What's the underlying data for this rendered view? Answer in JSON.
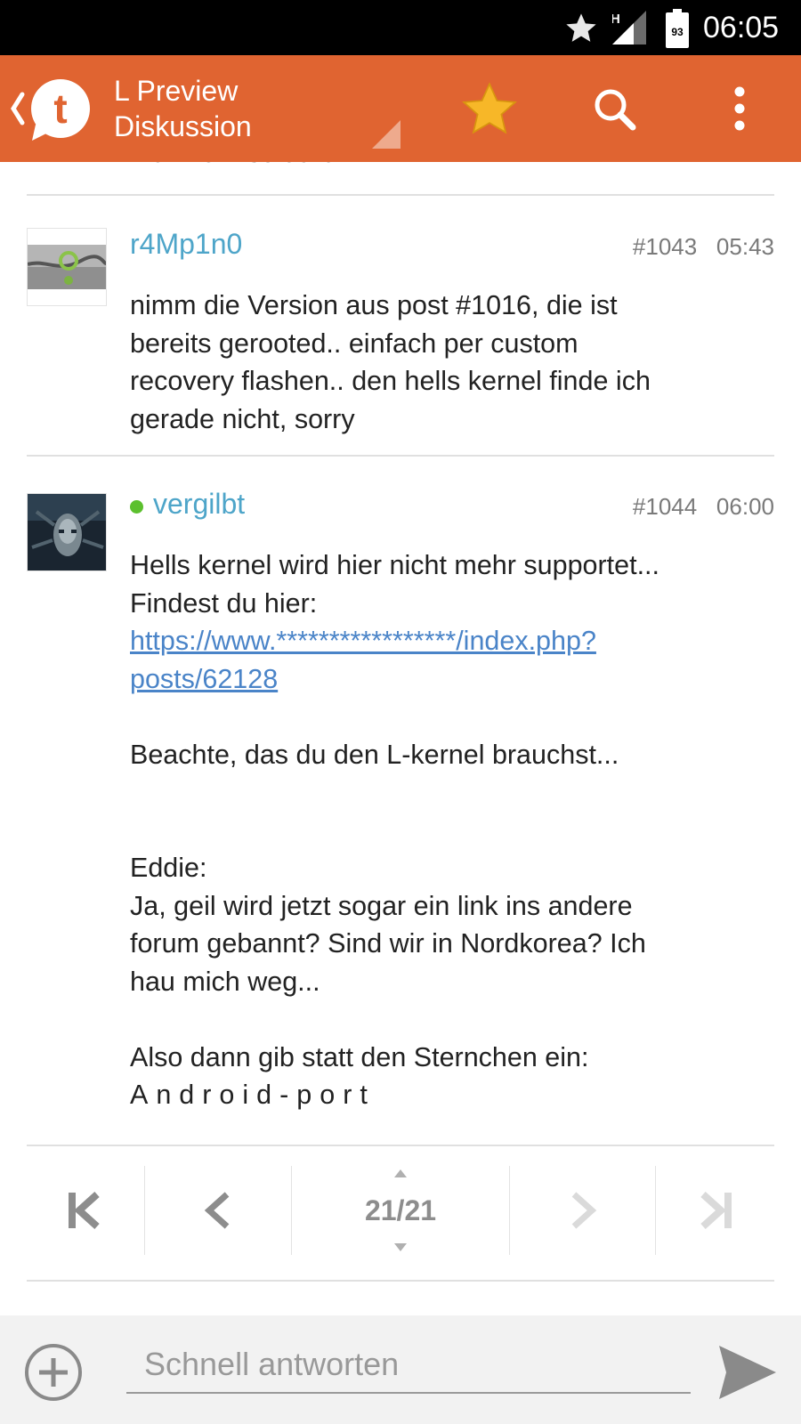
{
  "status_bar": {
    "time": "06:05",
    "network": "H",
    "battery": "93",
    "icons": [
      "star-icon",
      "signal-icon",
      "battery-icon"
    ]
  },
  "app_bar": {
    "title_line1": "L Preview",
    "title_line2": "Diskussion",
    "icons": [
      "back-chevron-icon",
      "app-logo-icon",
      "favorite-star-icon",
      "search-icon",
      "more-vert-icon"
    ],
    "accent_color": "#e06431",
    "star_color": "#f7b728"
  },
  "thread": {
    "partial_previous_text": "nichmehr so durch xD",
    "posts": [
      {
        "author": "r4Mp1n0",
        "number": "#1043",
        "time": "05:43",
        "online": false,
        "body_lines": [
          "nimm die Version aus post #1016, die ist",
          "bereits gerooted.. einfach per custom",
          "recovery flashen.. den hells kernel finde ich",
          "gerade nicht, sorry"
        ]
      },
      {
        "author": "vergilbt",
        "number": "#1044",
        "time": "06:00",
        "online": true,
        "online_color": "#5cc02e",
        "line1": "Hells kernel wird hier nicht mehr supportet...",
        "line2": "Findest du hier:",
        "link_line1": "https://www.*****************/index.php?",
        "link_line2": "posts/62128",
        "line3": "Beachte, das du den L-kernel brauchst...",
        "line4": "Eddie:",
        "line5": "Ja, geil wird jetzt sogar ein link ins andere",
        "line6": "forum gebannt? Sind wir in Nordkorea? Ich",
        "line7": "hau mich weg...",
        "line8": "Also dann gib statt den Sternchen ein:",
        "line9": "Android-port"
      }
    ]
  },
  "pagination": {
    "current": "21/21",
    "icons": [
      "first-page-icon",
      "previous-page-icon",
      "next-page-icon",
      "last-page-icon"
    ]
  },
  "reply": {
    "placeholder": "Schnell antworten",
    "icons": [
      "add-circle-icon",
      "send-icon"
    ]
  }
}
